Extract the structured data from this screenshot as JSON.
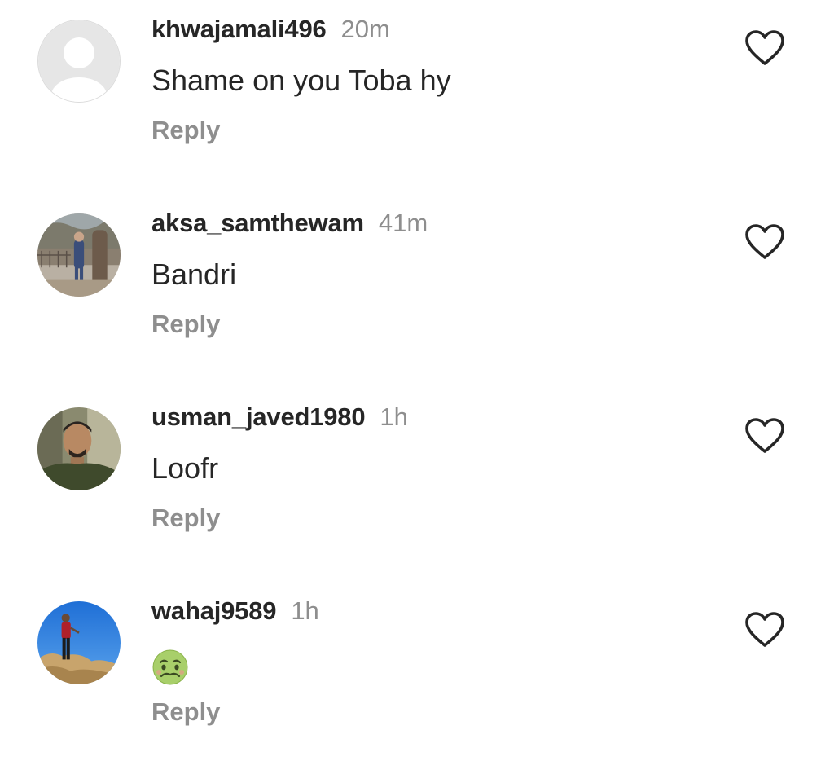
{
  "comments": [
    {
      "username": "khwajamali496",
      "time": "20m",
      "text": "Shame on you Toba hy",
      "reply_label": "Reply",
      "avatar_icon": "default-avatar-icon",
      "like_icon": "heart-outline-icon"
    },
    {
      "username": "aksa_samthewam",
      "time": "41m",
      "text": "Bandri",
      "reply_label": "Reply",
      "avatar_icon": "photo-avatar-icon",
      "like_icon": "heart-outline-icon"
    },
    {
      "username": "usman_javed1980",
      "time": "1h",
      "text": "Loofr",
      "reply_label": "Reply",
      "avatar_icon": "photo-avatar-icon",
      "like_icon": "heart-outline-icon"
    },
    {
      "username": "wahaj9589",
      "time": "1h",
      "text_emoji": "nauseated-face-emoji",
      "reply_label": "Reply",
      "avatar_icon": "photo-avatar-icon",
      "like_icon": "heart-outline-icon"
    }
  ],
  "colors": {
    "primary_text": "#262626",
    "secondary_text": "#8e8e8e",
    "background": "#ffffff"
  }
}
